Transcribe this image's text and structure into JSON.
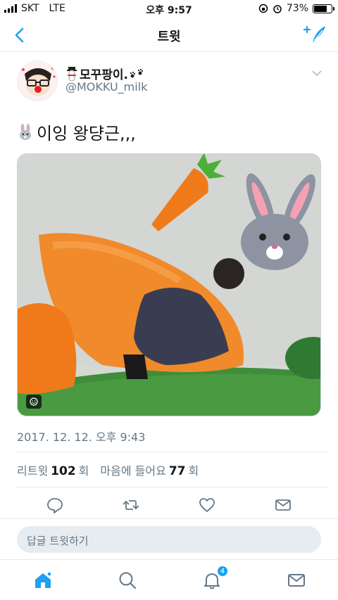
{
  "status_bar": {
    "carrier": "SKT",
    "network": "LTE",
    "time": "오후 9:57",
    "battery_text": "73%",
    "battery_level": 0.73
  },
  "nav": {
    "title": "트윗"
  },
  "tweet": {
    "display_name": "모꾸팡이.",
    "handle": "@MOKKU_milk",
    "text": "이잉 왕댱근,,,",
    "timestamp": "2017. 12. 12. 오후 9:43",
    "retweets_label": "리트윗",
    "retweets_count": "102",
    "retweets_suffix": "회",
    "likes_label": "마음에 들어요",
    "likes_count": "77",
    "likes_suffix": "회"
  },
  "reply": {
    "placeholder": "답글 트윗하기"
  },
  "tab_bar": {
    "notifications_badge": "4"
  },
  "colors": {
    "accent": "#1da1f2",
    "secondary_text": "#657786"
  },
  "icons": {
    "back": "chevron-left-icon",
    "compose": "compose-tweet-icon",
    "caret": "chevron-down-icon",
    "reply": "reply-icon",
    "retweet": "retweet-icon",
    "like": "heart-icon",
    "dm": "envelope-icon",
    "home": "home-icon",
    "search": "search-icon",
    "notifications": "bell-icon",
    "messages": "envelope-icon"
  }
}
